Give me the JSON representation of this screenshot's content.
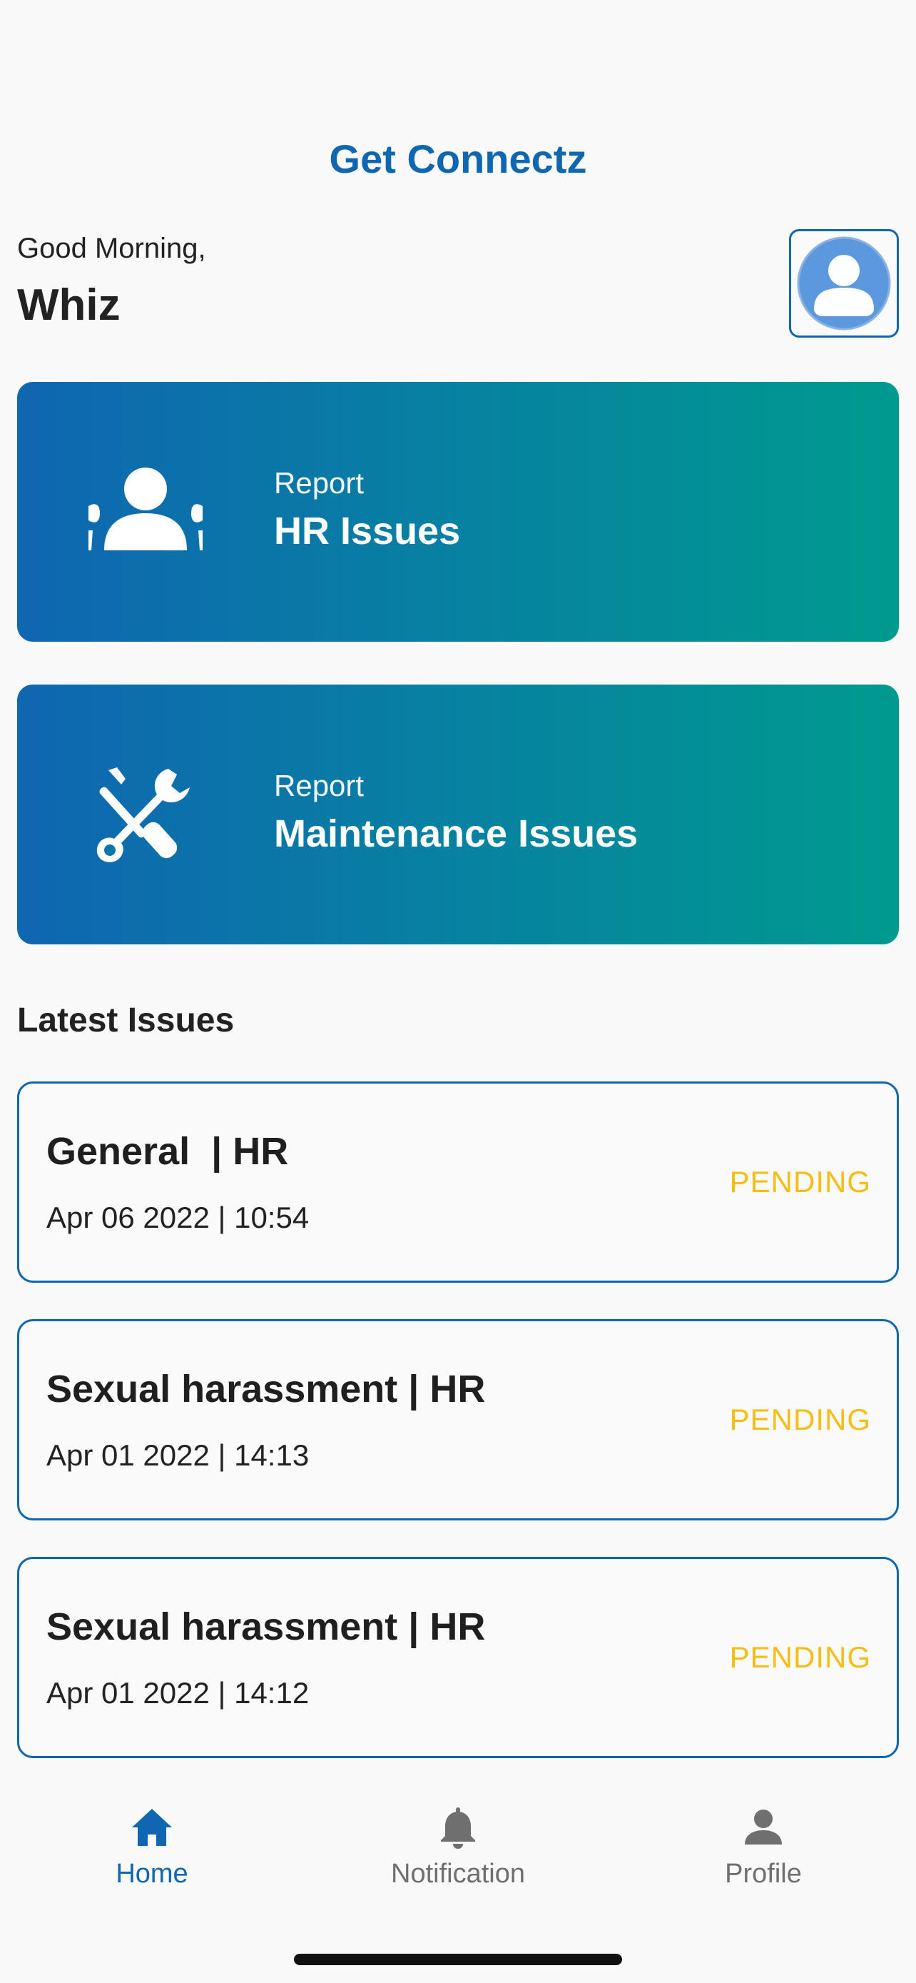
{
  "app": {
    "title": "Get Connectz"
  },
  "header": {
    "greeting": "Good Morning,",
    "username": "Whiz"
  },
  "report_cards": [
    {
      "small_label": "Report",
      "title": "HR Issues",
      "icon": "people-group-icon"
    },
    {
      "small_label": "Report",
      "title": "Maintenance Issues",
      "icon": "tools-icon"
    }
  ],
  "latest": {
    "heading": "Latest Issues",
    "issues": [
      {
        "title": "General  | HR",
        "date": "Apr 06 2022 | 10:54",
        "status": "PENDING"
      },
      {
        "title": "Sexual harassment | HR",
        "date": "Apr 01 2022 | 14:13",
        "status": "PENDING"
      },
      {
        "title": "Sexual harassment | HR",
        "date": "Apr 01 2022 | 14:12",
        "status": "PENDING"
      }
    ]
  },
  "bottom_nav": {
    "items": [
      {
        "label": "Home",
        "icon": "home-icon",
        "active": true
      },
      {
        "label": "Notification",
        "icon": "bell-icon",
        "active": false
      },
      {
        "label": "Profile",
        "icon": "person-icon",
        "active": false
      }
    ]
  },
  "colors": {
    "brand": "#0f66b1",
    "gradient_end": "#009a8f",
    "pending": "#f6bd16",
    "inactive": "#6f6f6f"
  }
}
